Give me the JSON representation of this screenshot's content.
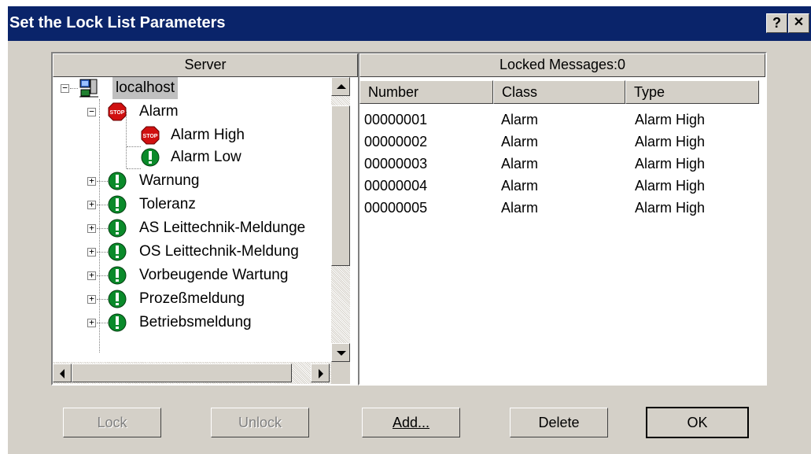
{
  "window": {
    "title": "Set the Lock List Parameters",
    "help_label": "?",
    "close_label": "✕"
  },
  "server_panel": {
    "header": "Server",
    "root": {
      "label": "localhost",
      "icon": "server-computer-icon"
    },
    "nodes": [
      {
        "label": "Alarm",
        "icon": "stop-sign-icon",
        "expanded": true
      },
      {
        "label": "Alarm High",
        "icon": "stop-sign-icon"
      },
      {
        "label": "Alarm Low",
        "icon": "green-exclamation-icon"
      },
      {
        "label": "Warnung",
        "icon": "green-exclamation-icon"
      },
      {
        "label": "Toleranz",
        "icon": "green-exclamation-icon"
      },
      {
        "label": "AS Leittechnik-Meldunge",
        "icon": "green-exclamation-icon"
      },
      {
        "label": "OS Leittechnik-Meldung",
        "icon": "green-exclamation-icon"
      },
      {
        "label": "Vorbeugende Wartung",
        "icon": "green-exclamation-icon"
      },
      {
        "label": "Prozeßmeldung",
        "icon": "green-exclamation-icon"
      },
      {
        "label": "Betriebsmeldung",
        "icon": "green-exclamation-icon"
      }
    ]
  },
  "locked_panel": {
    "header": "Locked Messages:0",
    "columns": [
      "Number",
      "Class",
      "Type"
    ],
    "rows": [
      [
        "00000001",
        "Alarm",
        "Alarm High"
      ],
      [
        "00000002",
        "Alarm",
        "Alarm High"
      ],
      [
        "00000003",
        "Alarm",
        "Alarm High"
      ],
      [
        "00000004",
        "Alarm",
        "Alarm High"
      ],
      [
        "00000005",
        "Alarm",
        "Alarm High"
      ]
    ]
  },
  "buttons": {
    "lock": "Lock",
    "unlock": "Unlock",
    "add": "Add...",
    "delete": "Delete",
    "ok": "OK"
  },
  "colors": {
    "titlebar": "#0a246a",
    "dialog_face": "#d4d0c8",
    "stop_red": "#d01010",
    "exclamation_green": "#0a8a2a"
  }
}
